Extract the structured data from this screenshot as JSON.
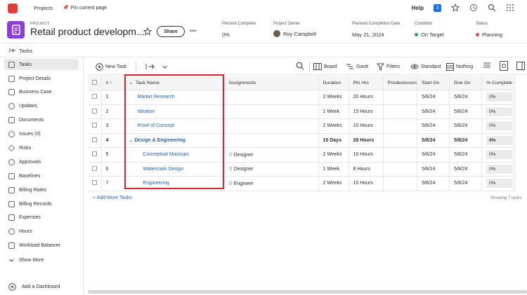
{
  "topbar": {
    "projects": "Projects",
    "pin": "Pin current page",
    "help": "Help",
    "notifications_count": "3"
  },
  "header": {
    "label": "PROJECT",
    "title": "Retail product developm...",
    "share": "Share",
    "fields": [
      {
        "key": "Percent Complete",
        "value": "0%"
      },
      {
        "key": "Project Owner",
        "value": "Roy Campbell"
      },
      {
        "key": "Planned Completion Date",
        "value": "May 21, 2024"
      },
      {
        "key": "Condition",
        "value": "On Target",
        "color": "#2d9d78"
      },
      {
        "key": "Status",
        "value": "Planning",
        "color": "#e34850"
      }
    ]
  },
  "subtab": "Tasks",
  "sidebar": {
    "items": [
      "Tasks",
      "Project Details",
      "Business Case",
      "Updates",
      "Documents",
      "Issues (0)",
      "Risks",
      "Approvals",
      "Baselines",
      "Billing Rates",
      "Billing Records",
      "Expenses",
      "Hours",
      "Workload Balancer",
      "Show More"
    ],
    "add_dashboard": "Add a Dashboard"
  },
  "toolbar": {
    "new_task": "New Task",
    "board": "Board",
    "gantt": "Gantt",
    "filters": "Filters",
    "standard": "Standard",
    "nothing": "Nothing"
  },
  "table": {
    "headers": [
      "#",
      "Task Name",
      "Assignments",
      "Duration",
      "Pln Hrs",
      "Predecessors",
      "Start On",
      "Due On",
      "% Complete"
    ],
    "rows": [
      {
        "num": "1",
        "name": "Market Research",
        "assign": "",
        "duration": "2 Weeks",
        "hrs": "20 Hours",
        "pred": "",
        "start": "5/8/24",
        "due": "5/8/24",
        "pct": "0%"
      },
      {
        "num": "2",
        "name": "Ideation",
        "assign": "",
        "duration": "1 Week",
        "hrs": "15 Hours",
        "pred": "",
        "start": "5/8/24",
        "due": "5/8/24",
        "pct": "0%"
      },
      {
        "num": "3",
        "name": "Proof of Concept",
        "assign": "",
        "duration": "2 Weeks",
        "hrs": "10 Hours",
        "pred": "",
        "start": "5/8/24",
        "due": "5/8/24",
        "pct": "0%"
      },
      {
        "num": "4",
        "name": "Design & Engineering",
        "assign": "",
        "duration": "10 Days",
        "hrs": "28 Hours",
        "pred": "",
        "start": "5/8/24",
        "due": "5/8/24",
        "pct": "0%"
      },
      {
        "num": "5",
        "name": "Conceptual Mackups",
        "assign": "Designer",
        "duration": "2 Weeks",
        "hrs": "10 Hours",
        "pred": "",
        "start": "5/8/24",
        "due": "5/8/24",
        "pct": "0%"
      },
      {
        "num": "6",
        "name": "Watermark Design",
        "assign": "Designer",
        "duration": "1 Week",
        "hrs": "8 Hours",
        "pred": "",
        "start": "5/8/24",
        "due": "5/8/24",
        "pct": "0%"
      },
      {
        "num": "7",
        "name": "Engineering",
        "assign": "Engineer",
        "duration": "2 Weeks",
        "hrs": "10 Hours",
        "pred": "",
        "start": "5/8/24",
        "due": "5/8/24",
        "pct": "0%"
      }
    ],
    "add_more": "+ Add More Tasks",
    "showing": "Showing 7 tasks"
  }
}
